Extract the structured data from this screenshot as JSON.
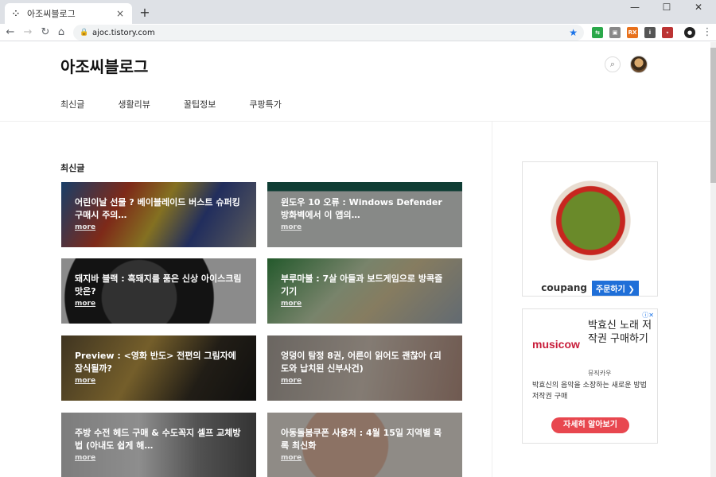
{
  "browser": {
    "tab_title": "아조씨블로그",
    "tab_close": "×",
    "new_tab": "+",
    "url": "ajoc.tistory.com",
    "window": {
      "minimize": "—",
      "maximize": "☐",
      "close": "✕"
    }
  },
  "blog": {
    "title": "아조씨블로그",
    "menu": [
      "최신글",
      "생활리뷰",
      "꿀팁정보",
      "쿠팡특가"
    ],
    "section_title": "최신글",
    "more_label": "more",
    "posts": [
      {
        "title": "어린이날 선물 ? 베이블레이드 버스트 슈퍼킹 구매시 주의…"
      },
      {
        "title": "윈도우 10 오류 : Windows Defender 방화벽에서 이 앱의…"
      },
      {
        "title": "돼지바 블랙 : 흑돼지를 품은 신상 아이스크림 맛은?"
      },
      {
        "title": "부루마불 : 7살 아들과 보드게임으로 방콕즐기기"
      },
      {
        "title": "Preview : <영화 반도> 전편의 그림자에 잠식될까?"
      },
      {
        "title": "엉덩이 탐정 8권, 어른이 읽어도 괜찮아 (괴도와 납치된 신부사건)"
      },
      {
        "title": "주방 수전 헤드 구매 & 수도꼭지 셀프 교체방법 (아내도 쉽게 해…"
      },
      {
        "title": "아동돌봄쿠폰 사용처 : 4월 15일 지역별 목록 최신화"
      }
    ]
  },
  "ads": {
    "coupang": {
      "brand": "coupang",
      "order": "주문하기 ❯"
    },
    "music": {
      "logo": "musicow",
      "headline": "박효신 노래 저작권 구매하기",
      "sponsor": "뮤직카우",
      "desc": "박효신의 음악을 소장하는 새로운 방법 저작권 구매",
      "cta": "자세히 알아보기",
      "adchoice": "ⓘ✕"
    }
  }
}
